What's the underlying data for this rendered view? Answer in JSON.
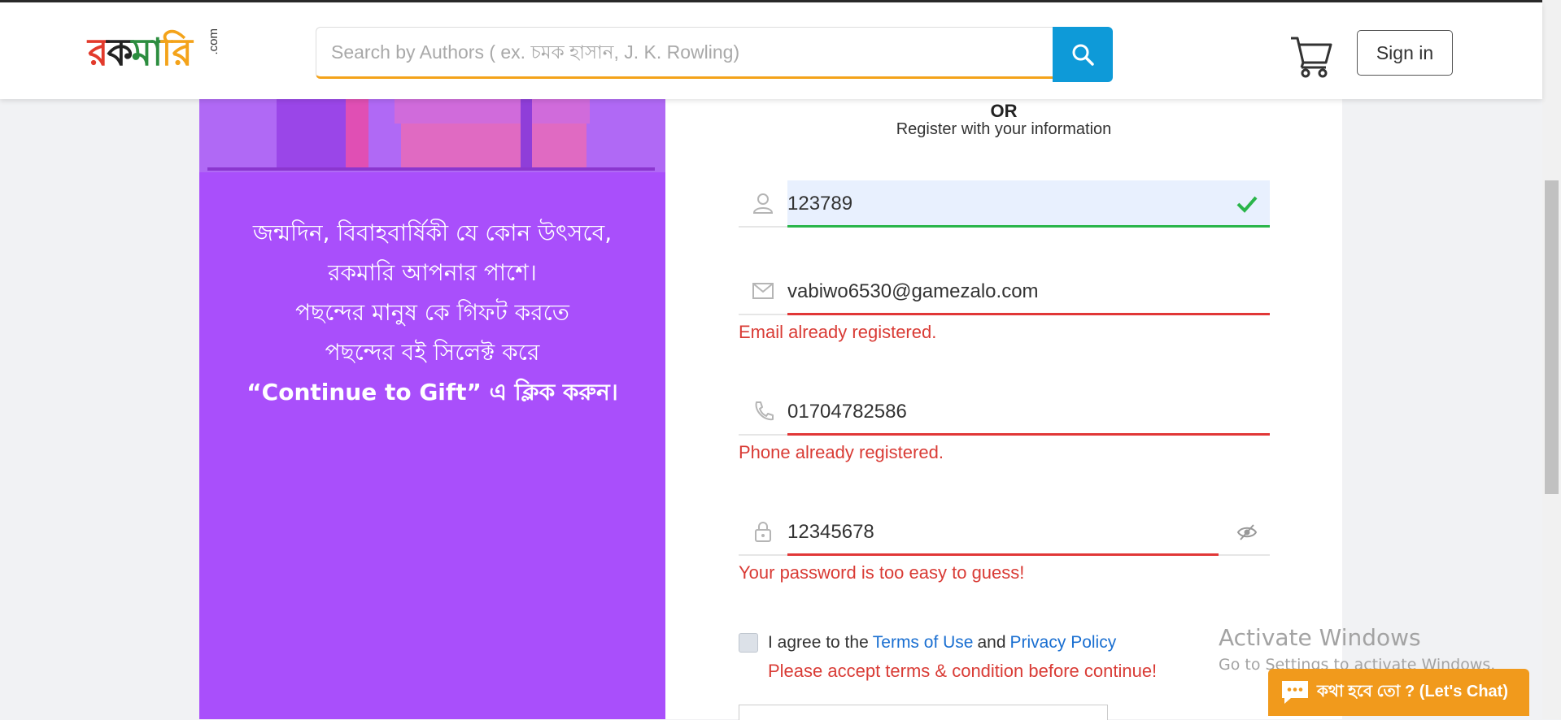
{
  "header": {
    "logo": {
      "text_parts": [
        "র",
        "ক",
        "মা",
        "রি"
      ],
      "suffix": ".com"
    },
    "search": {
      "placeholder": "Search by Authors ( ex. চমক হাসান, J. K. Rowling)"
    },
    "sign_in_label": "Sign in"
  },
  "promo": {
    "lines": [
      "জন্মদিন, বিবাহবার্ষিকী যে কোন উৎসবে,",
      "রকমারি আপনার পাশে।",
      "পছন্দের মানুষ কে গিফট করতে",
      "পছন্দের বই সিলেক্ট করে",
      "“Continue to Gift” এ ক্লিক করুন।"
    ]
  },
  "form": {
    "or_label": "OR",
    "subtitle": "Register with your information",
    "name_value": "123789",
    "email_value": "vabiwo6530@gamezalo.com",
    "email_error": "Email already registered.",
    "phone_value": "01704782586",
    "phone_error": "Phone already registered.",
    "password_value": "12345678",
    "password_error": "Your password is too easy to guess!",
    "agree_prefix": "I agree to the",
    "terms_link": "Terms of Use",
    "and_text": "and",
    "privacy_link": "Privacy Policy",
    "terms_error": "Please accept terms & condition before continue!"
  },
  "watermark": {
    "line1": "Activate Windows",
    "line2": "Go to Settings to activate Windows."
  },
  "chat": {
    "label": "কথা হবে তো ? (Let's Chat)"
  },
  "colors": {
    "brand_orange": "#f4a31a",
    "search_blue": "#0e9ad8",
    "promo_purple": "#a94ffb",
    "error_red": "#d93b35",
    "success_green": "#2ab54a",
    "link_blue": "#1a6fd1"
  }
}
